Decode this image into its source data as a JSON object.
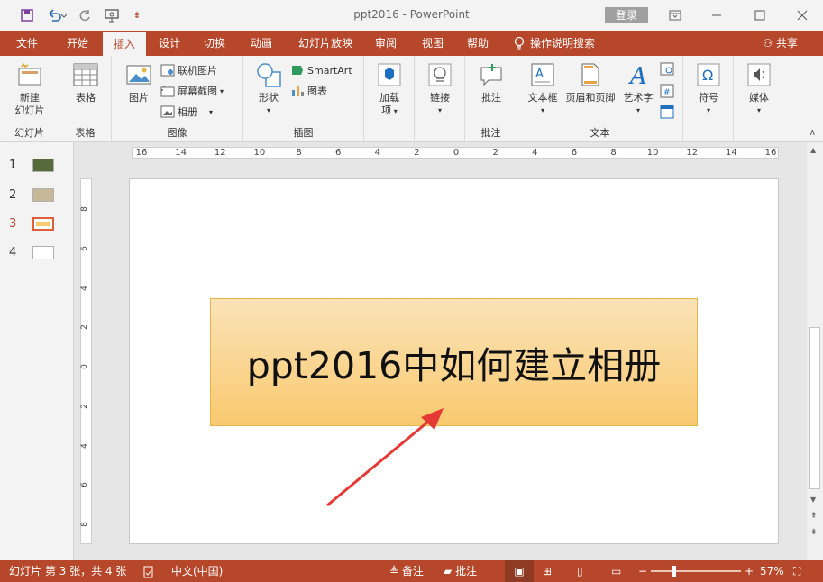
{
  "window": {
    "doc_name": "ppt2016",
    "app_name": "PowerPoint",
    "title_sep": " - ",
    "login_label": "登录"
  },
  "tabs": [
    "文件",
    "开始",
    "插入",
    "设计",
    "切换",
    "动画",
    "幻灯片放映",
    "审阅",
    "视图",
    "帮助"
  ],
  "search_label": "操作说明搜索",
  "share_label": "共享",
  "ribbon": {
    "new_slide_line1": "新建",
    "new_slide_line2": "幻灯片",
    "group_slides": "幻灯片",
    "table": "表格",
    "group_table": "表格",
    "picture": "图片",
    "online_pictures": "联机图片",
    "screenshot": "屏幕截图",
    "photo_album": "相册",
    "group_images": "图像",
    "shapes": "形状",
    "smartart": "SmartArt",
    "chart": "图表",
    "group_illustrations": "插图",
    "addins_line1": "加载",
    "addins_line2": "项",
    "link": "链接",
    "comment": "批注",
    "group_comments": "批注",
    "textbox": "文本框",
    "header_footer": "页眉和页脚",
    "wordart": "艺术字",
    "group_text": "文本",
    "symbol": "符号",
    "media": "媒体"
  },
  "thumbnails": [
    "1",
    "2",
    "3",
    "4"
  ],
  "ruler_h": [
    "16",
    "14",
    "12",
    "10",
    "8",
    "6",
    "4",
    "2",
    "0",
    "2",
    "4",
    "6",
    "8",
    "10",
    "12",
    "14",
    "16"
  ],
  "ruler_v": [
    "8",
    "6",
    "4",
    "2",
    "0",
    "2",
    "4",
    "6",
    "8"
  ],
  "slide": {
    "title_text": "ppt2016中如何建立相册"
  },
  "status": {
    "slide_info": "幻灯片 第 3 张，共 4 张",
    "language": "中文(中国)",
    "notes": "备注",
    "comments": "批注",
    "zoom": "57%"
  },
  "colors": {
    "accent": "#b7472a",
    "title_fill_top": "#fbe3b8",
    "title_fill_bottom": "#f9c96f",
    "arrow": "#e53935"
  }
}
